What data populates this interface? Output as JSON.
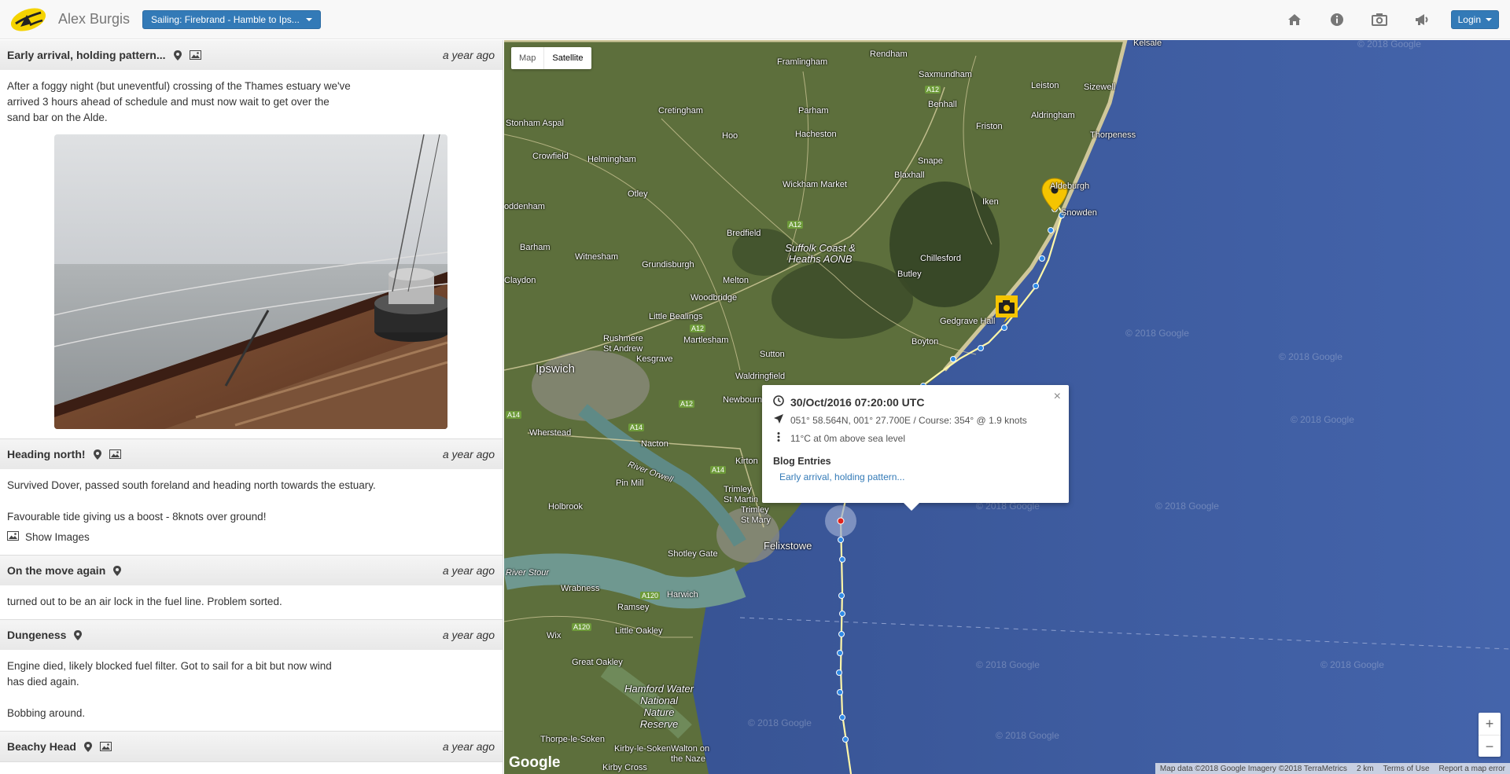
{
  "navbar": {
    "brand_name": "Alex Burgis",
    "trip_selector": "Sailing: Firebrand - Hamble to Ips...",
    "icons": [
      "home-icon",
      "info-icon",
      "camera-icon",
      "bullhorn-icon"
    ],
    "login_label": "Login"
  },
  "entries": [
    {
      "title": "Early arrival, holding pattern...",
      "time": "a year ago",
      "has_location": true,
      "has_images": true,
      "body": [
        "After a foggy night (but uneventful) crossing of the Thames estuary we've",
        "arrived 3 hours ahead of schedule and must now wait to get over the",
        "sand bar on the Alde."
      ]
    },
    {
      "title": "Heading north!",
      "time": "a year ago",
      "body1": "Survived Dover, passed south foreland and heading north towards the estuary.",
      "body2": "Favourable tide giving us a boost - 8knots over ground!",
      "show_images": "Show Images"
    },
    {
      "title": "On the move again",
      "time": "a year ago",
      "body": "turned out to be an air lock in the fuel line. Problem sorted."
    },
    {
      "title": "Dungeness",
      "time": "a year ago",
      "body1": "Engine died, likely blocked fuel filter. Got to sail for a bit but now wind",
      "body1b": "has died again.",
      "body2": "Bobbing around."
    },
    {
      "title": "Beachy Head",
      "time": "a year ago"
    }
  ],
  "map": {
    "type_map": "Map",
    "type_satellite": "Satellite",
    "selected_type": "Satellite",
    "zoom_in": "+",
    "zoom_out": "−",
    "google_logo": "Google",
    "watermark": "© 2018 Google",
    "attribution": {
      "data": "Map data ©2018 Google Imagery ©2018 TerraMetrics",
      "scale": "2 km",
      "terms": "Terms of Use",
      "report": "Report a map error"
    },
    "places": [
      "Kelsale",
      "Framlingham",
      "Rendham",
      "Saxmundham",
      "Leiston",
      "Sizewell",
      "Benhall",
      "Aldringham",
      "Thorpeness",
      "Cretingham",
      "Parham",
      "Friston",
      "Stonham Aspal",
      "Hacheston",
      "Hoo",
      "Crowfield",
      "Helmingham",
      "Snape",
      "Aldeburgh",
      "Wickham Market",
      "Blaxhall",
      "Iken",
      "Otley",
      "Coddenham",
      "Bredfield",
      "Suffolk Coast & Heaths AONB",
      "Chillesford",
      "Barham",
      "Witnesham",
      "Grundisburgh",
      "Melton",
      "Butley",
      "Claydon",
      "Woodbridge",
      "Gedgrave Hall",
      "Little Bealings",
      "Rushmere St Andrew",
      "Martlesham",
      "Boyton",
      "Ipswich",
      "Kesgrave",
      "Sutton",
      "Waldringfield",
      "Newbourne",
      "Wherstead",
      "Nacton",
      "Kirton",
      "River Orwell",
      "Pin Mill",
      "Trimley St Martin",
      "Trimley St Mary",
      "Holbrook",
      "Shotley Gate",
      "Felixstowe",
      "River Stour",
      "Wrabness",
      "Harwich",
      "Ramsey",
      "Little Oakley",
      "Wix",
      "Great Oakley",
      "Hamford Water National Nature Reserve",
      "Thorpe-le-Soken",
      "Kirby-le-Soken",
      "Walton on the Naze",
      "Kirby Cross",
      "Snowden"
    ],
    "roads": [
      "A12",
      "A12",
      "A12",
      "A14",
      "A14",
      "A12",
      "A14",
      "A120",
      "A120"
    ]
  },
  "info_window": {
    "time": "30/Oct/2016 07:20:00 UTC",
    "position": "051° 58.564N, 001° 27.700E / Course: 354° @ 1.9 knots",
    "weather": "11°C at 0m above sea level",
    "blog_heading": "Blog Entries",
    "blog_link": "Early arrival, holding pattern...",
    "close": "×"
  },
  "colors": {
    "navbar_bg": "#f8f8f8",
    "primary": "#337ab7",
    "sea": "#3d5a9e",
    "land": "#5d6f3c",
    "track": "#fff7a8",
    "track_point": "#2f8ae6",
    "marker_yellow": "#f5c400"
  }
}
